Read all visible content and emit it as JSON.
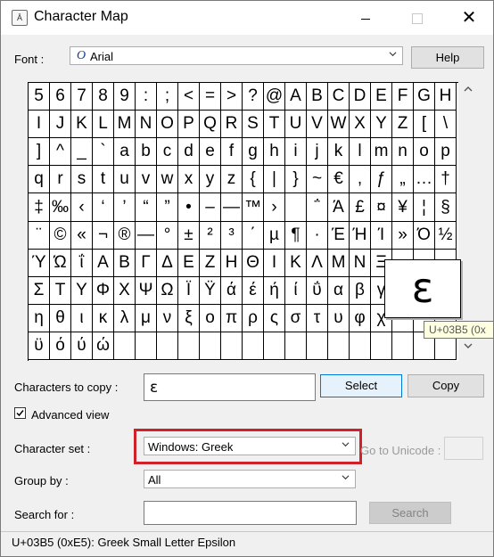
{
  "window": {
    "title": "Character Map"
  },
  "font": {
    "label": "Font :",
    "value": "Arial",
    "font_icon": "O",
    "help_label": "Help"
  },
  "grid": {
    "rows": [
      [
        "5",
        "6",
        "7",
        "8",
        "9",
        ":",
        ";",
        "<",
        "=",
        ">",
        "?",
        "@",
        "A",
        "B",
        "C",
        "D",
        "E",
        "F",
        "G",
        "H"
      ],
      [
        "I",
        "J",
        "K",
        "L",
        "M",
        "N",
        "O",
        "P",
        "Q",
        "R",
        "S",
        "T",
        "U",
        "V",
        "W",
        "X",
        "Y",
        "Z",
        "[",
        "\\"
      ],
      [
        "]",
        "^",
        "_",
        "`",
        "a",
        "b",
        "c",
        "d",
        "e",
        "f",
        "g",
        "h",
        "i",
        "j",
        "k",
        "l",
        "m",
        "n",
        "o",
        "p"
      ],
      [
        "q",
        "r",
        "s",
        "t",
        "u",
        "v",
        "w",
        "x",
        "y",
        "z",
        "{",
        "|",
        "}",
        "~",
        "€",
        ",",
        "ƒ",
        "„",
        "…",
        "†"
      ],
      [
        "‡",
        "‰",
        "‹",
        "‘",
        "’",
        "“",
        "”",
        "•",
        "–",
        "—",
        "™",
        "›",
        "",
        "΅",
        "Ά",
        "£",
        "¤",
        "¥",
        "¦",
        "§"
      ],
      [
        "¨",
        "©",
        "«",
        "¬",
        "®",
        "―",
        "°",
        "±",
        "²",
        "³",
        "΄",
        "µ",
        "¶",
        "·",
        "Έ",
        "Ή",
        "Ί",
        "»",
        "Ό",
        "½"
      ],
      [
        "Ύ",
        "Ώ",
        "ΐ",
        "Α",
        "Β",
        "Γ",
        "Δ",
        "Ε",
        "Ζ",
        "Η",
        "Θ",
        "Ι",
        "Κ",
        "Λ",
        "Μ",
        "Ν",
        "Ξ",
        "",
        "",
        ""
      ],
      [
        "Σ",
        "Τ",
        "Υ",
        "Φ",
        "Χ",
        "Ψ",
        "Ω",
        "Ϊ",
        "Ϋ",
        "ά",
        "έ",
        "ή",
        "ί",
        "ΰ",
        "α",
        "β",
        "γ",
        "",
        "",
        ""
      ],
      [
        "η",
        "θ",
        "ι",
        "κ",
        "λ",
        "μ",
        "ν",
        "ξ",
        "ο",
        "π",
        "ρ",
        "ς",
        "σ",
        "τ",
        "υ",
        "φ",
        "χ",
        "",
        "",
        ""
      ],
      [
        "ϋ",
        "ό",
        "ύ",
        "ώ",
        "",
        "",
        "",
        "",
        "",
        "",
        "",
        "",
        "",
        "",
        "",
        "",
        "",
        "",
        "",
        ""
      ]
    ],
    "zoom_char": "ε",
    "tooltip": "U+03B5 (0x"
  },
  "copy": {
    "label": "Characters to copy :",
    "value": "ε",
    "select_label": "Select",
    "copy_label": "Copy"
  },
  "advanced": {
    "label": "Advanced view",
    "checked": true
  },
  "charset": {
    "label": "Character set :",
    "value": "Windows: Greek",
    "goto_label": "Go to Unicode :"
  },
  "groupby": {
    "label": "Group by :",
    "value": "All"
  },
  "search": {
    "label": "Search for :",
    "value": "",
    "button_label": "Search"
  },
  "status": {
    "text": "U+03B5 (0xE5): Greek Small Letter Epsilon"
  },
  "colors": {
    "highlight": "#d0202a",
    "primary_border": "#0078d7"
  }
}
